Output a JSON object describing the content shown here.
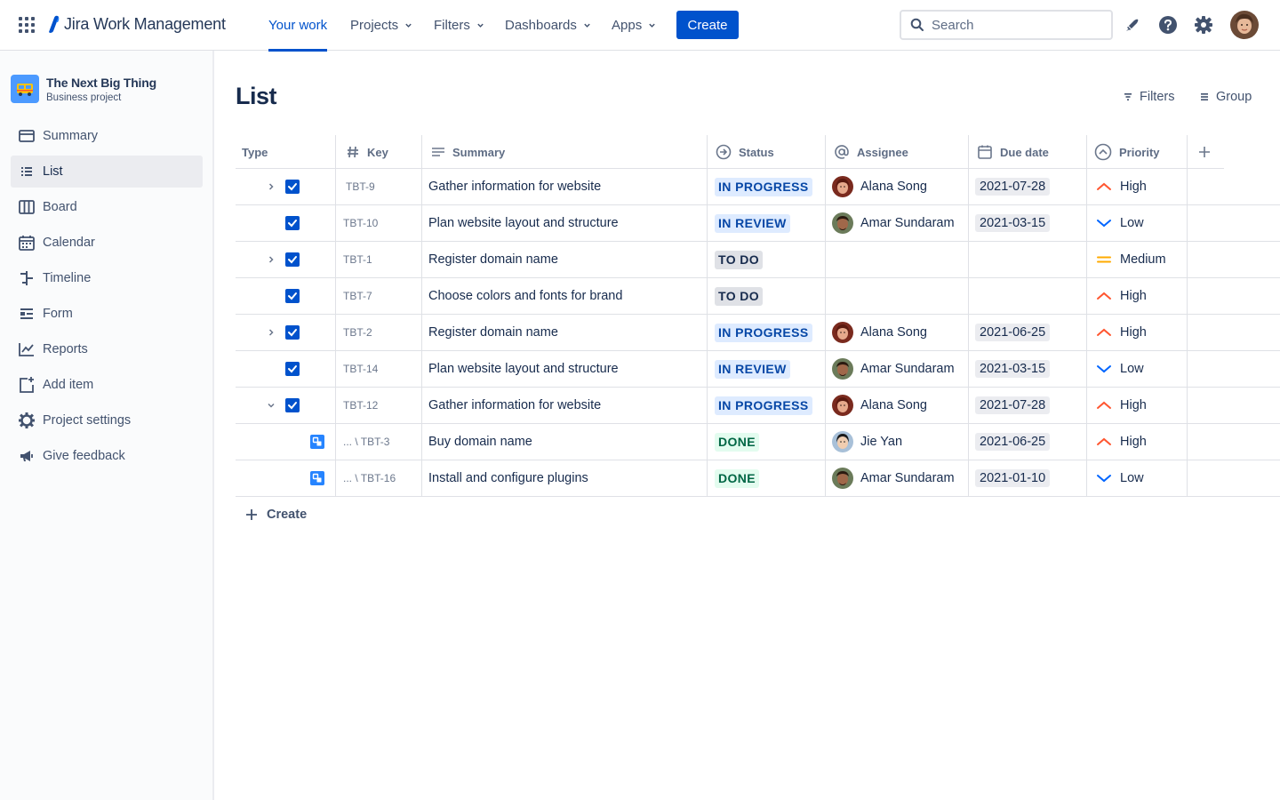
{
  "app": {
    "name": "Jira Work Management"
  },
  "nav": {
    "your_work": "Your work",
    "projects": "Projects",
    "filters": "Filters",
    "dashboards": "Dashboards",
    "apps": "Apps",
    "create": "Create",
    "search_placeholder": "Search"
  },
  "project": {
    "name": "The Next Big Thing",
    "type": "Business project"
  },
  "sidebar": {
    "items": [
      {
        "label": "Summary",
        "icon": "summary-icon"
      },
      {
        "label": "List",
        "icon": "list-icon",
        "active": true
      },
      {
        "label": "Board",
        "icon": "board-icon"
      },
      {
        "label": "Calendar",
        "icon": "calendar-icon"
      },
      {
        "label": "Timeline",
        "icon": "timeline-icon"
      },
      {
        "label": "Form",
        "icon": "form-icon"
      },
      {
        "label": "Reports",
        "icon": "reports-icon"
      },
      {
        "label": "Add item",
        "icon": "add-item-icon"
      },
      {
        "label": "Project settings",
        "icon": "gear-icon"
      },
      {
        "label": "Give feedback",
        "icon": "megaphone-icon"
      }
    ]
  },
  "page": {
    "title": "List",
    "filters_label": "Filters",
    "group_label": "Group"
  },
  "table": {
    "columns": {
      "type": "Type",
      "key": "Key",
      "summary": "Summary",
      "status": "Status",
      "assignee": "Assignee",
      "due_date": "Due date",
      "priority": "Priority"
    },
    "rows": [
      {
        "key": "TBT-9",
        "summary": "Gather information for website",
        "status": "IN PROGRESS",
        "assignee": "Alana Song",
        "due": "2021-07-28",
        "priority": "High"
      },
      {
        "key": "TBT-10",
        "summary": "Plan website layout and structure",
        "status": "IN REVIEW",
        "assignee": "Amar Sundaram",
        "due": "2021-03-15",
        "priority": "Low"
      },
      {
        "key": "TBT-1",
        "summary": "Register domain name",
        "status": "TO DO",
        "assignee": "",
        "due": "",
        "priority": "Medium"
      },
      {
        "key": "TBT-7",
        "summary": "Choose colors and fonts for brand",
        "status": "TO DO",
        "assignee": "",
        "due": "",
        "priority": "High"
      },
      {
        "key": "TBT-2",
        "summary": "Register domain name",
        "status": "IN PROGRESS",
        "assignee": "Alana Song",
        "due": "2021-06-25",
        "priority": "High"
      },
      {
        "key": "TBT-14",
        "summary": "Plan website layout and structure",
        "status": "IN REVIEW",
        "assignee": "Amar Sundaram",
        "due": "2021-03-15",
        "priority": "Low"
      },
      {
        "key": "TBT-12",
        "summary": "Gather information for website",
        "status": "IN PROGRESS",
        "assignee": "Alana Song",
        "due": "2021-07-28",
        "priority": "High"
      },
      {
        "key": "... \\ TBT-3",
        "summary": "Buy domain name",
        "status": "DONE",
        "assignee": "Jie Yan",
        "due": "2021-06-25",
        "priority": "High"
      },
      {
        "key": "... \\ TBT-16",
        "summary": "Install and configure plugins",
        "status": "DONE",
        "assignee": "Amar Sundaram",
        "due": "2021-01-10",
        "priority": "Low"
      }
    ],
    "create_label": "Create"
  },
  "colors": {
    "brand": "#0052cc",
    "high": "#ff5630",
    "low": "#0065ff",
    "medium": "#ffab00"
  }
}
